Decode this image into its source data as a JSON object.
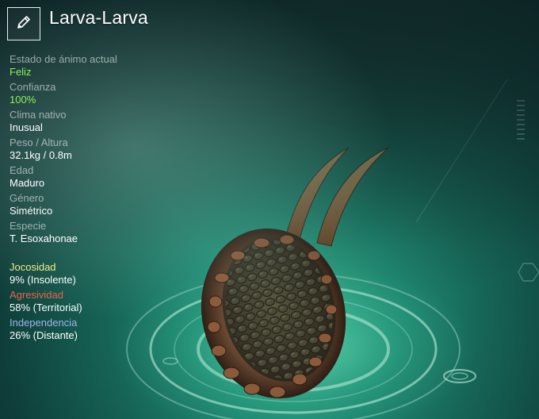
{
  "title": "Larva-Larva",
  "edit_icon": "pencil-icon",
  "stats": [
    {
      "label": "Estado de ánimo actual",
      "value": "Feliz",
      "highlight": true
    },
    {
      "label": "Confianza",
      "value": "100%",
      "highlight": true
    },
    {
      "label": "Clima nativo",
      "value": "Inusual",
      "highlight": false
    },
    {
      "label": "Peso / Altura",
      "value": "32.1kg / 0.8m",
      "highlight": false
    },
    {
      "label": "Edad",
      "value": "Maduro",
      "highlight": false
    },
    {
      "label": "Género",
      "value": "Simétrico",
      "highlight": false
    },
    {
      "label": "Especie",
      "value": "T. Esoxahonae",
      "highlight": false
    }
  ],
  "traits": [
    {
      "label": "Jocosidad",
      "value": "9% (Insolente)",
      "color": "#f2ea86"
    },
    {
      "label": "Agresividad",
      "value": "58% (Territorial)",
      "color": "#e3664e"
    },
    {
      "label": "Independencia",
      "value": "26% (Distante)",
      "color": "#9fb4ee"
    }
  ],
  "colors": {
    "highlight": "#8df05a",
    "background": "#1f8a72"
  }
}
